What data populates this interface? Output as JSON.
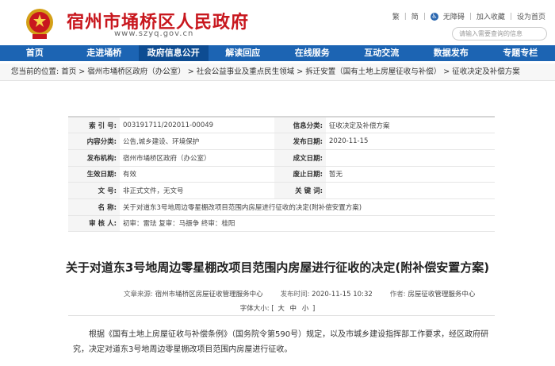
{
  "header": {
    "site_title": "宿州市埇桥区人民政府",
    "site_url": "www.szyq.gov.cn",
    "emblem_icon": "national-emblem-icon",
    "top_links": {
      "link1": "繁",
      "link2": "简",
      "accessibility_label": "无障碍",
      "link3": "加入收藏",
      "link4": "设为首页"
    },
    "search_placeholder": "请输入需要查询的信息"
  },
  "nav": {
    "items": [
      "首页",
      "走进埇桥",
      "政府信息公开",
      "解读回应",
      "在线服务",
      "互动交流",
      "数据发布",
      "专题专栏"
    ],
    "active_index": 2
  },
  "breadcrumb": {
    "text": "您当前的位置:  首页  >  宿州市埇桥区政府（办公室）  >  社会公益事业及重点民生领域  >  拆迁安置（国有土地上房屋征收与补偿）  >  征收决定及补偿方案"
  },
  "info": {
    "index_no_label": "索  引  号:",
    "index_no": "003191711/202011-00049",
    "category_label": "信息分类:",
    "category": "征收决定及补偿方案",
    "content_category_label": "内容分类:",
    "content_category": "公告,城乡建设、环境保护",
    "pub_date_label": "发布日期:",
    "pub_date": "2020-11-15",
    "publisher_label": "发布机构:",
    "publisher": "宿州市埇桥区政府（办公室）",
    "issue_date_label": "成文日期:",
    "issue_date": "",
    "effective_date_label": "生效日期:",
    "effective_date": "有效",
    "expiry_date_label": "废止日期:",
    "expiry_date": "暂无",
    "doc_no_label": "文      号:",
    "doc_no": "非正式文件，无文号",
    "keywords_label": "关 键 词:",
    "keywords": "",
    "name_label": "名      称:",
    "name": "关于对道东3号地周边零星棚改项目范围内房屋进行征收的决定(附补偿安置方案)",
    "reviewers_label": "审 核 人:",
    "reviewers": "初审：雷珐      复审：马振争      终审：桂阳"
  },
  "article": {
    "title": "关于对道东3号地周边零星棚改项目范围内房屋进行征收的决定(附补偿安置方案)",
    "source_label": "文章来源:",
    "source": "宿州市埇桥区房屋征收管理服务中心",
    "time_label": "发布时间:",
    "time": "2020-11-15 10:32",
    "author_label": "作者:",
    "author": "房屋征收管理服务中心",
    "font_size_label": "字体大小:",
    "font_sizes": [
      "大",
      "中",
      "小"
    ],
    "body": "根据《国有土地上房屋征收与补偿条例》（国务院令第590号）规定，以及市城乡建设指挥部工作要求，经区政府研究，决定对道东3号地周边零星棚改项目范围内房屋进行征收。"
  },
  "colors": {
    "brand_red": "#c8171e",
    "nav_blue": "#1c64b3",
    "nav_active": "#0d4c92"
  }
}
